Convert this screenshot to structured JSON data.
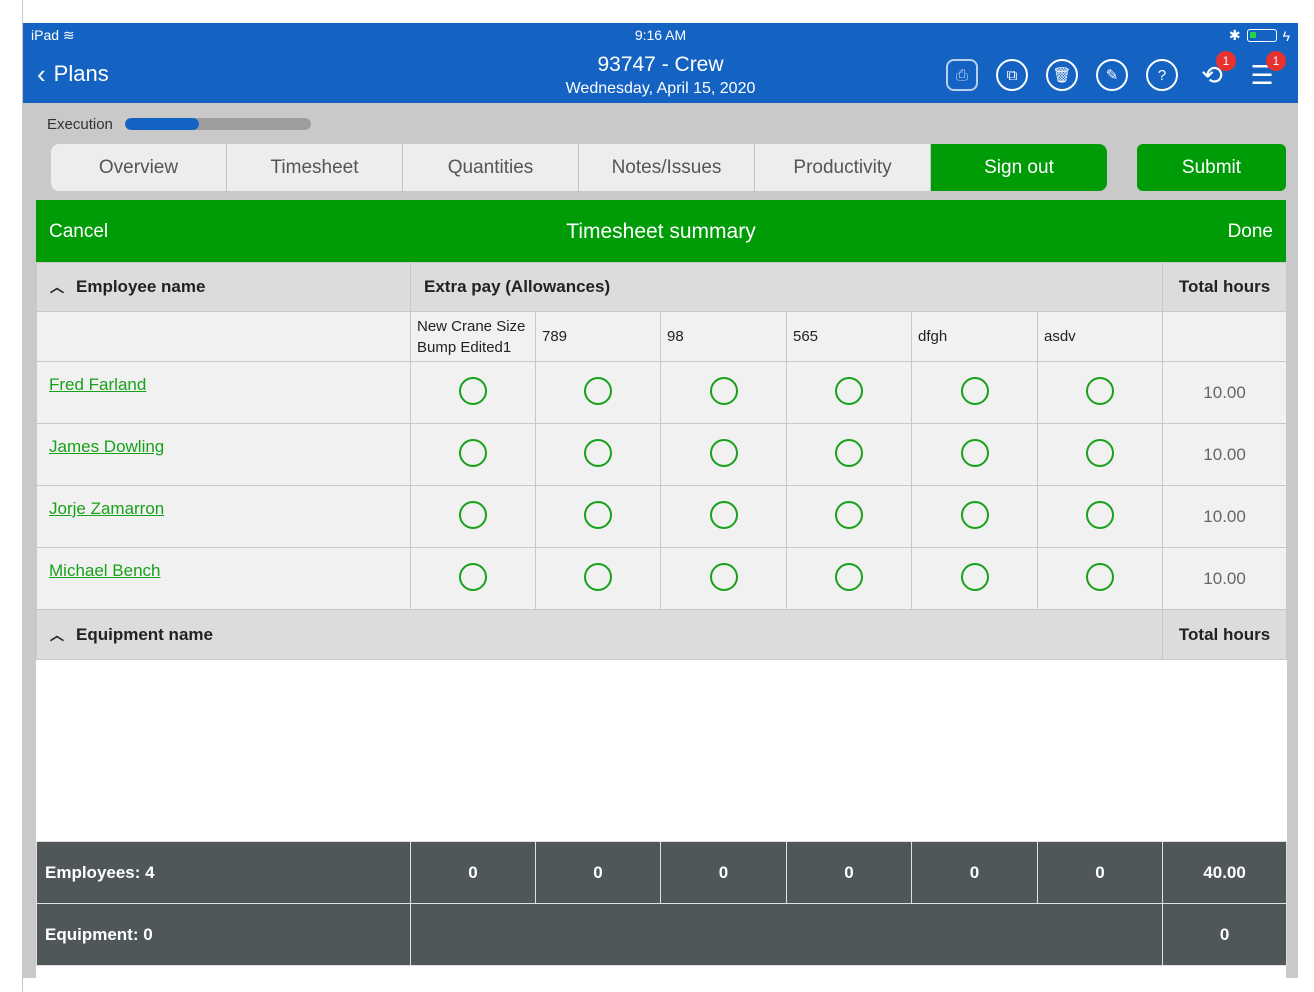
{
  "status_bar": {
    "device": "iPad",
    "time": "9:16 AM"
  },
  "header": {
    "back_label": "Plans",
    "title": "93747 - Crew",
    "date": "Wednesday, April 15, 2020",
    "icons": [
      "stamp-icon",
      "copy-icon",
      "trash-icon",
      "edit-icon",
      "help-icon",
      "sync-icon",
      "menu-icon"
    ],
    "badges": {
      "sync": "1",
      "menu": "1"
    }
  },
  "execution": {
    "label": "Execution",
    "progress": 0.4
  },
  "tabs": [
    "Overview",
    "Timesheet",
    "Quantities",
    "Notes/Issues",
    "Productivity",
    "Sign out"
  ],
  "submit_label": "Submit",
  "modal": {
    "cancel": "Cancel",
    "title": "Timesheet summary",
    "done": "Done"
  },
  "table": {
    "employee_header": "Employee name",
    "extra_pay_header": "Extra pay (Allowances)",
    "total_hours_header": "Total hours",
    "allowances": [
      "New Crane Size Bump Edited1",
      "789",
      "98",
      "565",
      "dfgh",
      "asdv"
    ],
    "employees": [
      {
        "name": "Fred Farland",
        "hours": "10.00"
      },
      {
        "name": "James Dowling",
        "hours": "10.00"
      },
      {
        "name": "Jorje Zamarron",
        "hours": "10.00"
      },
      {
        "name": "Michael Bench",
        "hours": "10.00"
      }
    ],
    "equipment_header": "Equipment name",
    "equipment_total_header": "Total hours"
  },
  "footer": {
    "employees_label": "Employees: 4",
    "allowance_totals": [
      "0",
      "0",
      "0",
      "0",
      "0",
      "0"
    ],
    "employees_total": "40.00",
    "equipment_label": "Equipment: 0",
    "equipment_total": "0"
  },
  "colors": {
    "header_blue": "#1463c2",
    "accent_green": "#009c08",
    "footer_gray": "#4f5758"
  }
}
